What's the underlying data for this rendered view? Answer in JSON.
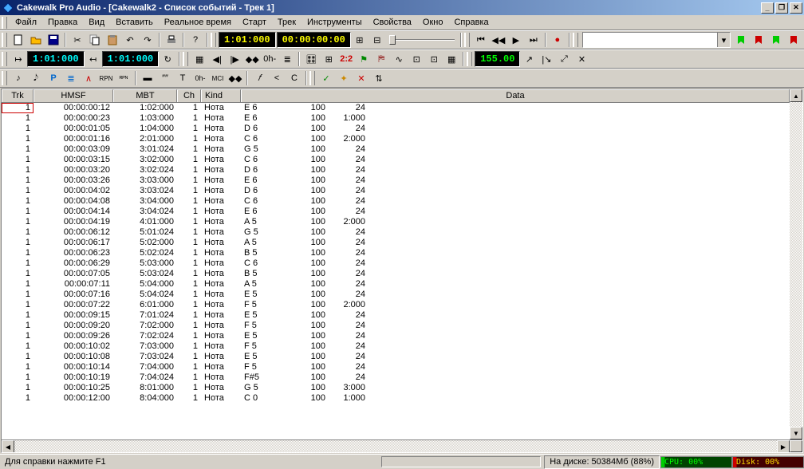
{
  "window": {
    "title": "Cakewalk Pro Audio - [Cakewalk2 - Список событий - Трек 1]"
  },
  "menu": [
    "Файл",
    "Правка",
    "Вид",
    "Вставить",
    "Реальное время",
    "Старт",
    "Трек",
    "Инструменты",
    "Свойства",
    "Окно",
    "Справка"
  ],
  "transport": {
    "pos_mbt": "1:01:000",
    "pos_time": "00:00:00:00"
  },
  "loop": {
    "from": "1:01:000",
    "to": "1:01:000"
  },
  "tempo": "155.00",
  "snap_ratio": "2:2",
  "columns": [
    "Trk",
    "HMSF",
    "MBT",
    "Ch",
    "Kind",
    "Data"
  ],
  "events": [
    {
      "trk": "1",
      "hmsf": "00:00:00:12",
      "mbt": "1:02:000",
      "ch": "1",
      "kind": "Нота",
      "d1": "E 6",
      "d2": "100",
      "d3": "24"
    },
    {
      "trk": "1",
      "hmsf": "00:00:00:23",
      "mbt": "1:03:000",
      "ch": "1",
      "kind": "Нота",
      "d1": "E 6",
      "d2": "100",
      "d3": "1:000"
    },
    {
      "trk": "1",
      "hmsf": "00:00:01:05",
      "mbt": "1:04:000",
      "ch": "1",
      "kind": "Нота",
      "d1": "D 6",
      "d2": "100",
      "d3": "24"
    },
    {
      "trk": "1",
      "hmsf": "00:00:01:16",
      "mbt": "2:01:000",
      "ch": "1",
      "kind": "Нота",
      "d1": "C 6",
      "d2": "100",
      "d3": "2:000"
    },
    {
      "trk": "1",
      "hmsf": "00:00:03:09",
      "mbt": "3:01:024",
      "ch": "1",
      "kind": "Нота",
      "d1": "G 5",
      "d2": "100",
      "d3": "24"
    },
    {
      "trk": "1",
      "hmsf": "00:00:03:15",
      "mbt": "3:02:000",
      "ch": "1",
      "kind": "Нота",
      "d1": "C 6",
      "d2": "100",
      "d3": "24"
    },
    {
      "trk": "1",
      "hmsf": "00:00:03:20",
      "mbt": "3:02:024",
      "ch": "1",
      "kind": "Нота",
      "d1": "D 6",
      "d2": "100",
      "d3": "24"
    },
    {
      "trk": "1",
      "hmsf": "00:00:03:26",
      "mbt": "3:03:000",
      "ch": "1",
      "kind": "Нота",
      "d1": "E 6",
      "d2": "100",
      "d3": "24"
    },
    {
      "trk": "1",
      "hmsf": "00:00:04:02",
      "mbt": "3:03:024",
      "ch": "1",
      "kind": "Нота",
      "d1": "D 6",
      "d2": "100",
      "d3": "24"
    },
    {
      "trk": "1",
      "hmsf": "00:00:04:08",
      "mbt": "3:04:000",
      "ch": "1",
      "kind": "Нота",
      "d1": "C 6",
      "d2": "100",
      "d3": "24"
    },
    {
      "trk": "1",
      "hmsf": "00:00:04:14",
      "mbt": "3:04:024",
      "ch": "1",
      "kind": "Нота",
      "d1": "E 6",
      "d2": "100",
      "d3": "24"
    },
    {
      "trk": "1",
      "hmsf": "00:00:04:19",
      "mbt": "4:01:000",
      "ch": "1",
      "kind": "Нота",
      "d1": "A 5",
      "d2": "100",
      "d3": "2:000"
    },
    {
      "trk": "1",
      "hmsf": "00:00:06:12",
      "mbt": "5:01:024",
      "ch": "1",
      "kind": "Нота",
      "d1": "G 5",
      "d2": "100",
      "d3": "24"
    },
    {
      "trk": "1",
      "hmsf": "00:00:06:17",
      "mbt": "5:02:000",
      "ch": "1",
      "kind": "Нота",
      "d1": "A 5",
      "d2": "100",
      "d3": "24"
    },
    {
      "trk": "1",
      "hmsf": "00:00:06:23",
      "mbt": "5:02:024",
      "ch": "1",
      "kind": "Нота",
      "d1": "B 5",
      "d2": "100",
      "d3": "24"
    },
    {
      "trk": "1",
      "hmsf": "00:00:06:29",
      "mbt": "5:03:000",
      "ch": "1",
      "kind": "Нота",
      "d1": "C 6",
      "d2": "100",
      "d3": "24"
    },
    {
      "trk": "1",
      "hmsf": "00:00:07:05",
      "mbt": "5:03:024",
      "ch": "1",
      "kind": "Нота",
      "d1": "B 5",
      "d2": "100",
      "d3": "24"
    },
    {
      "trk": "1",
      "hmsf": "00:00:07:11",
      "mbt": "5:04:000",
      "ch": "1",
      "kind": "Нота",
      "d1": "A 5",
      "d2": "100",
      "d3": "24"
    },
    {
      "trk": "1",
      "hmsf": "00:00:07:16",
      "mbt": "5:04:024",
      "ch": "1",
      "kind": "Нота",
      "d1": "E 5",
      "d2": "100",
      "d3": "24"
    },
    {
      "trk": "1",
      "hmsf": "00:00:07:22",
      "mbt": "6:01:000",
      "ch": "1",
      "kind": "Нота",
      "d1": "F 5",
      "d2": "100",
      "d3": "2:000"
    },
    {
      "trk": "1",
      "hmsf": "00:00:09:15",
      "mbt": "7:01:024",
      "ch": "1",
      "kind": "Нота",
      "d1": "E 5",
      "d2": "100",
      "d3": "24"
    },
    {
      "trk": "1",
      "hmsf": "00:00:09:20",
      "mbt": "7:02:000",
      "ch": "1",
      "kind": "Нота",
      "d1": "F 5",
      "d2": "100",
      "d3": "24"
    },
    {
      "trk": "1",
      "hmsf": "00:00:09:26",
      "mbt": "7:02:024",
      "ch": "1",
      "kind": "Нота",
      "d1": "E 5",
      "d2": "100",
      "d3": "24"
    },
    {
      "trk": "1",
      "hmsf": "00:00:10:02",
      "mbt": "7:03:000",
      "ch": "1",
      "kind": "Нота",
      "d1": "F 5",
      "d2": "100",
      "d3": "24"
    },
    {
      "trk": "1",
      "hmsf": "00:00:10:08",
      "mbt": "7:03:024",
      "ch": "1",
      "kind": "Нота",
      "d1": "E 5",
      "d2": "100",
      "d3": "24"
    },
    {
      "trk": "1",
      "hmsf": "00:00:10:14",
      "mbt": "7:04:000",
      "ch": "1",
      "kind": "Нота",
      "d1": "F 5",
      "d2": "100",
      "d3": "24"
    },
    {
      "trk": "1",
      "hmsf": "00:00:10:19",
      "mbt": "7:04:024",
      "ch": "1",
      "kind": "Нота",
      "d1": "F#5",
      "d2": "100",
      "d3": "24"
    },
    {
      "trk": "1",
      "hmsf": "00:00:10:25",
      "mbt": "8:01:000",
      "ch": "1",
      "kind": "Нота",
      "d1": "G 5",
      "d2": "100",
      "d3": "3:000"
    },
    {
      "trk": "1",
      "hmsf": "00:00:12:00",
      "mbt": "8:04:000",
      "ch": "1",
      "kind": "Нота",
      "d1": "C 0",
      "d2": "100",
      "d3": "1:000"
    }
  ],
  "status": {
    "help": "Для справки нажмите F1",
    "disk_space": "На диске: 50384Мб (88%)",
    "cpu": "CPU: 00%",
    "disk": "Disk: 00%"
  },
  "toolbar3": {
    "btns": [
      "♪",
      "𝅘𝅥𝅮",
      "P",
      "≣",
      "∧",
      "RPN",
      "ᴿᴾᴺ",
      " ",
      "▬",
      "″″",
      "T",
      "0h-",
      "MCI",
      "◆◆",
      "𝑓",
      "<",
      "C",
      " ",
      "✓",
      "✦",
      "✕",
      "⇅"
    ]
  }
}
